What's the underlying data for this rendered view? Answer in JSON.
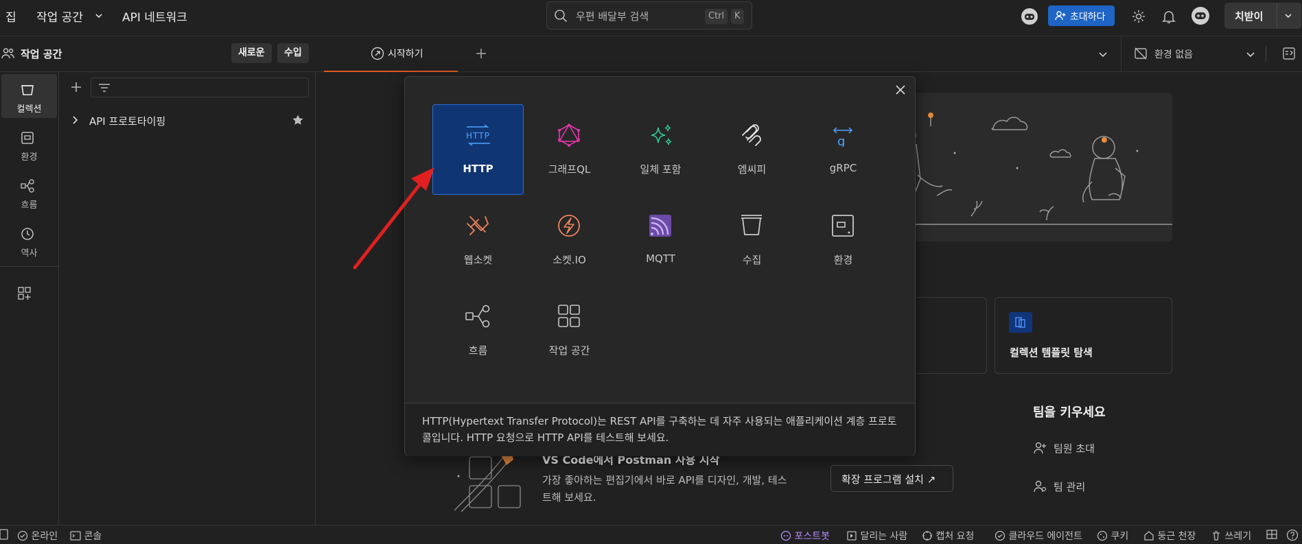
{
  "topbar": {
    "home": "집",
    "workspace": "작업 공간",
    "api_network": "API 네트워크",
    "search_placeholder": "우편 배달부 검색",
    "kbd_ctrl": "Ctrl",
    "kbd_k": "K",
    "invite": "초대하다",
    "upgrade": "치받이"
  },
  "sidebar": {
    "title": "작업 공간",
    "new_btn": "새로운",
    "import_btn": "수입",
    "rail": [
      "컬렉션",
      "환경",
      "흐름",
      "역사"
    ],
    "tree_item": "API 프로토타이핑"
  },
  "tabs": {
    "start": "시작하기",
    "env": "환경 없음"
  },
  "modal": {
    "tiles": [
      {
        "label": "HTTP",
        "icon": "http-icon"
      },
      {
        "label": "그래프QL",
        "icon": "graphql-icon"
      },
      {
        "label": "일체 포함",
        "icon": "ai-sparkle-icon"
      },
      {
        "label": "엠씨피",
        "icon": "mcp-icon"
      },
      {
        "label": "gRPC",
        "icon": "grpc-icon"
      },
      {
        "label": "웹소켓",
        "icon": "websocket-icon"
      },
      {
        "label": "소켓.IO",
        "icon": "socketio-icon"
      },
      {
        "label": "MQTT",
        "icon": "mqtt-icon"
      },
      {
        "label": "수집",
        "icon": "collection-icon"
      },
      {
        "label": "환경",
        "icon": "environment-icon"
      },
      {
        "label": "흐름",
        "icon": "flow-icon"
      },
      {
        "label": "작업 공간",
        "icon": "workspace-icon"
      }
    ],
    "description": "HTTP(Hypertext Transfer Protocol)는 REST API를 구축하는 데 자주 사용되는 애플리케이션 계층 프로토콜입니다. HTTP 요청으로 HTTP API를 테스트해 보세요."
  },
  "background": {
    "template_card": "컬렉션 템플릿 탐색",
    "team_title": "팀을 키우세요",
    "team_invite": "팀원 초대",
    "team_manage": "팀 관리",
    "vscode_title": "VS Code에서 Postman 사용 시작",
    "vscode_desc": "가장 좋아하는 편집기에서 바로 API를 디자인, 개발, 테스트해 보세요.",
    "install_btn": "확장 프로그램 설치 ↗"
  },
  "status": {
    "online": "온라인",
    "console": "콘솔",
    "postbot": "포스트봇",
    "runner": "달리는 사람",
    "capture": "캡처 요청",
    "cloud_agent": "클라우드 에이전트",
    "cookies": "쿠키",
    "vault": "둥근 천장",
    "trash": "쓰레기"
  },
  "colors": {
    "accent_orange": "#e05a22",
    "brand_blue": "#1f65c6",
    "selected_tile": "#0f3572",
    "arrow_red": "#e02020"
  }
}
